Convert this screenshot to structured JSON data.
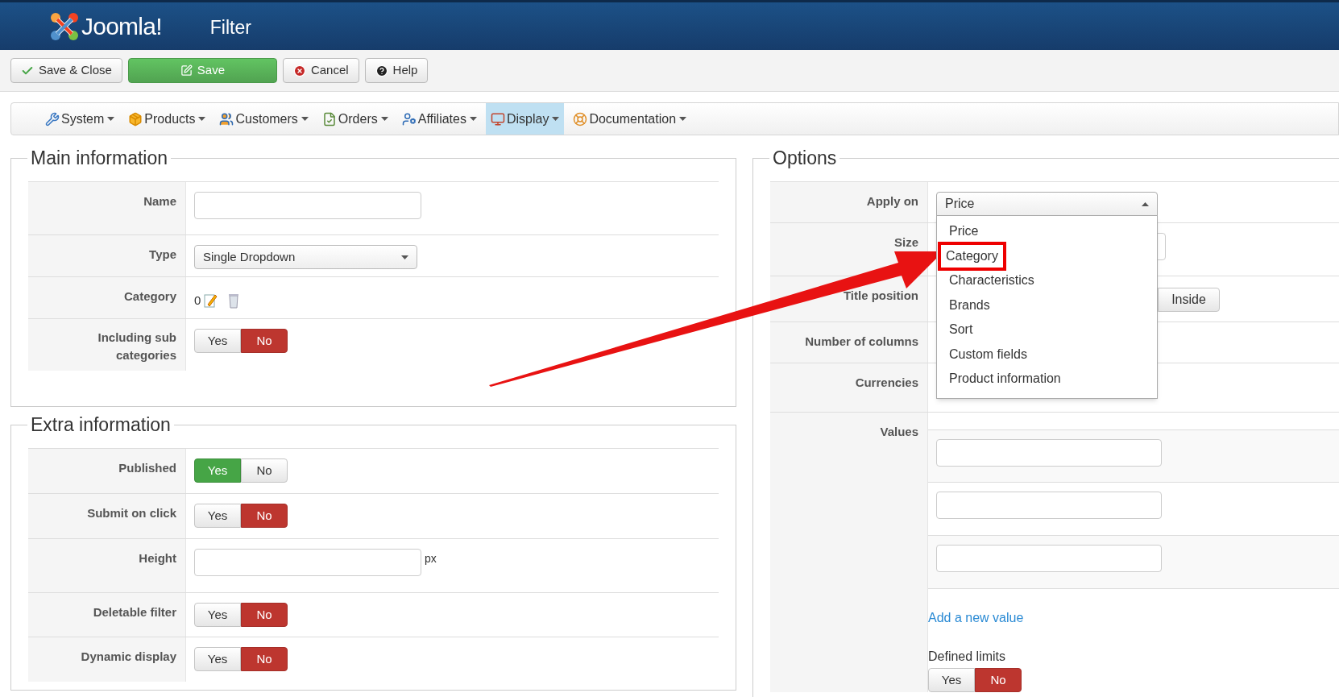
{
  "header": {
    "logo": "Joomla!",
    "title": "Filter"
  },
  "toolbar": [
    {
      "kind": "save_close",
      "label": "Save & Close"
    },
    {
      "kind": "save",
      "label": "Save"
    },
    {
      "kind": "cancel",
      "label": "Cancel"
    },
    {
      "kind": "help",
      "label": "Help"
    }
  ],
  "menu": [
    {
      "kind": "system",
      "label": "System",
      "selected": false
    },
    {
      "kind": "products",
      "label": "Products",
      "selected": false
    },
    {
      "kind": "customers",
      "label": "Customers",
      "selected": false
    },
    {
      "kind": "orders",
      "label": "Orders",
      "selected": false
    },
    {
      "kind": "affiliates",
      "label": "Affiliates",
      "selected": false
    },
    {
      "kind": "display",
      "label": "Display",
      "selected": true
    },
    {
      "kind": "documentation",
      "label": "Documentation",
      "selected": false
    }
  ],
  "main_information": {
    "legend": "Main information",
    "rows": [
      {
        "kind": "text",
        "label": "Name"
      },
      {
        "kind": "select",
        "label": "Type",
        "value": "Single Dropdown"
      },
      {
        "kind": "category",
        "label": "Category",
        "value": "0"
      },
      {
        "kind": "toggle",
        "label": "Including sub categories",
        "options": [
          {
            "label": "Yes",
            "selected": false
          },
          {
            "label": "No",
            "selected": true
          }
        ]
      }
    ]
  },
  "extra_information": {
    "legend": "Extra information",
    "rows": [
      {
        "kind": "toggle",
        "label": "Published",
        "options": [
          {
            "label": "Yes",
            "selected": true
          },
          {
            "label": "No",
            "selected": false
          }
        ]
      },
      {
        "kind": "toggle",
        "label": "Submit on click",
        "options": [
          {
            "label": "Yes",
            "selected": false
          },
          {
            "label": "No",
            "selected": true
          }
        ]
      },
      {
        "kind": "text",
        "label": "Height",
        "suffix": "px"
      },
      {
        "kind": "toggle",
        "label": "Deletable filter",
        "options": [
          {
            "label": "Yes",
            "selected": false
          },
          {
            "label": "No",
            "selected": true
          }
        ]
      },
      {
        "kind": "toggle",
        "label": "Dynamic display",
        "options": [
          {
            "label": "Yes",
            "selected": false
          },
          {
            "label": "No",
            "selected": true
          }
        ]
      }
    ]
  },
  "options": {
    "legend": "Options",
    "apply_on": {
      "label": "Apply on",
      "value": "Price",
      "expanded": true,
      "options": [
        {
          "label": "Price",
          "highlighted": false
        },
        {
          "label": "Category",
          "highlighted": true
        },
        {
          "label": "Characteristics",
          "highlighted": false
        },
        {
          "label": "Brands",
          "highlighted": false
        },
        {
          "label": "Sort",
          "highlighted": false
        },
        {
          "label": "Custom fields",
          "highlighted": false
        },
        {
          "label": "Product information",
          "highlighted": false
        }
      ]
    },
    "size": {
      "label": "Size"
    },
    "title_position": {
      "label": "Title position",
      "options": [
        {
          "label": "Inside",
          "selected": false
        }
      ]
    },
    "number_of_columns": {
      "label": "Number of columns"
    },
    "currencies": {
      "label": "Currencies"
    },
    "values": {
      "label": "Values",
      "fields": [
        {
          "kind": "text"
        },
        {
          "kind": "text"
        },
        {
          "kind": "text"
        }
      ],
      "add_link": "Add a new value",
      "limits_label": "Defined limits",
      "limits": [
        {
          "label": "Yes",
          "selected": false
        },
        {
          "label": "No",
          "selected": true
        }
      ]
    }
  }
}
